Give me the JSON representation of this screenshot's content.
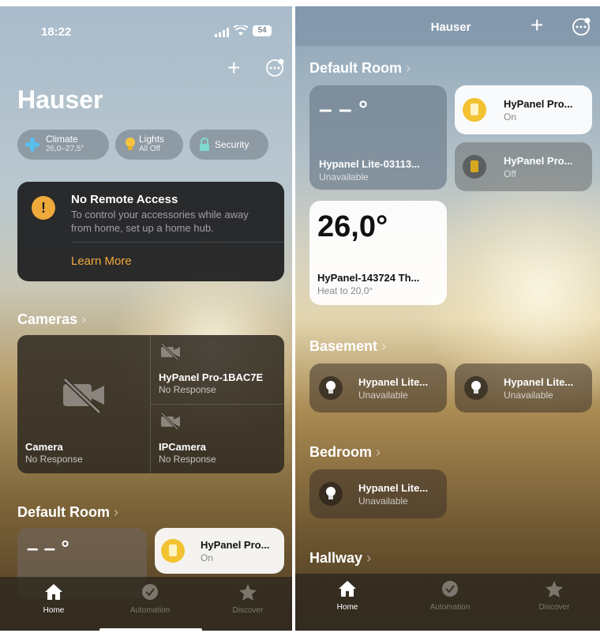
{
  "left": {
    "status_bar": {
      "time": "18:22",
      "battery": "54"
    },
    "title": "Hauser",
    "summary": [
      {
        "label": "Climate",
        "sub": "26,0–27,5°"
      },
      {
        "label": "Lights",
        "sub": "All Off"
      },
      {
        "label": "Security",
        "sub": ""
      }
    ],
    "notice": {
      "title": "No Remote Access",
      "text_line1": "To control your accessories while away",
      "text_line2": "from home, set up a home hub.",
      "link": "Learn More"
    },
    "cameras_section": "Cameras",
    "cameras": [
      {
        "name": "Camera",
        "status": "No Response"
      },
      {
        "name": "HyPanel Pro-1BAC7E",
        "status": "No Response"
      },
      {
        "name": "IPCamera",
        "status": "No Response"
      }
    ],
    "default_room_section": "Default Room",
    "tiles": [
      {
        "value": "– – °"
      },
      {
        "name": "HyPanel Pro...",
        "status": "On"
      }
    ]
  },
  "right": {
    "header_title": "Hauser",
    "sections": [
      "Default Room",
      "Basement",
      "Bedroom",
      "Hallway"
    ],
    "default_room": [
      {
        "value": "– – °",
        "name": "Hypanel Lite-03113...",
        "status": "Unavailable"
      },
      {
        "name": "HyPanel Pro...",
        "status": "On"
      },
      {
        "name": "HyPanel Pro...",
        "status": "Off"
      },
      {
        "value": "26,0°",
        "name": "HyPanel-143724 Th...",
        "status": "Heat to 20,0°"
      }
    ],
    "basement": [
      {
        "name": "Hypanel Lite...",
        "status": "Unavailable"
      },
      {
        "name": "Hypanel Lite...",
        "status": "Unavailable"
      }
    ],
    "bedroom": [
      {
        "name": "Hypanel Lite...",
        "status": "Unavailable"
      }
    ]
  },
  "tabs": [
    "Home",
    "Automation",
    "Discover"
  ],
  "colors": {
    "accent_orange": "#f0a93b",
    "bulb_yellow": "#f5c542",
    "panel_yellow": "#f2c230"
  }
}
